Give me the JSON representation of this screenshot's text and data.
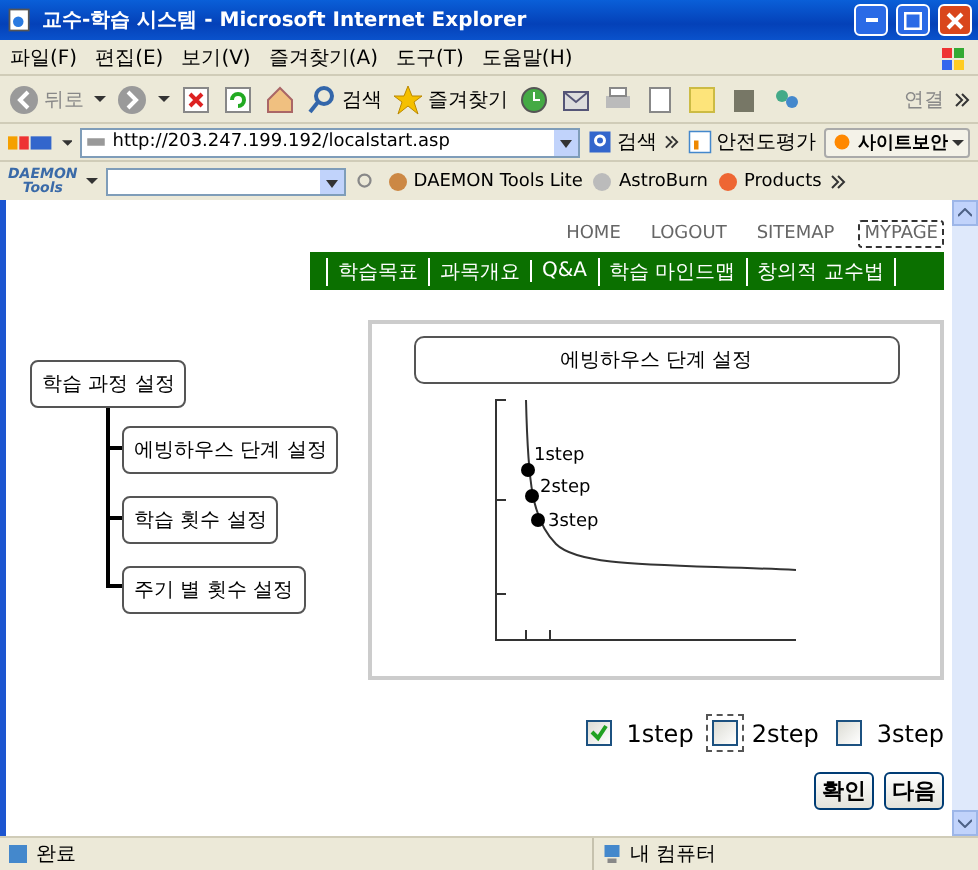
{
  "window": {
    "title": "교수-학습 시스템 - Microsoft Internet Explorer"
  },
  "menu_bar": [
    "파일(F)",
    "편집(E)",
    "보기(V)",
    "즐겨찾기(A)",
    "도구(T)",
    "도움말(H)"
  ],
  "toolbar": {
    "back": "뒤로",
    "search": "검색",
    "favorites": "즐겨찾기",
    "links": "연결"
  },
  "address_bar": {
    "url": "http://203.247.199.192/localstart.asp",
    "search": "검색",
    "safety": "안전도평가",
    "security": "사이트보안"
  },
  "daemon_bar": {
    "logo_top": "DAEMON",
    "logo_bottom": "Tools",
    "items": [
      "DAEMON Tools Lite",
      "AstroBurn",
      "Products"
    ]
  },
  "top_links": [
    {
      "label": "HOME",
      "focused": false
    },
    {
      "label": "LOGOUT",
      "focused": false
    },
    {
      "label": "SITEMAP",
      "focused": false
    },
    {
      "label": "MYPAGE",
      "focused": true
    }
  ],
  "nav": [
    "학습목표",
    "과목개요",
    "Q&A",
    "학습 마인드맵",
    "창의적 교수법"
  ],
  "tree": {
    "label": "학습 과정 설정",
    "children": [
      {
        "label": "에빙하우스 단계 설정"
      },
      {
        "label": "학습 횟수 설정"
      },
      {
        "label": "주기 별 횟수 설정"
      }
    ]
  },
  "panel": {
    "title": "에빙하우스 단계 설정",
    "curve_labels": [
      "1step",
      "2step",
      "3step"
    ]
  },
  "options": [
    {
      "label": "1step",
      "checked": true,
      "focused": false
    },
    {
      "label": "2step",
      "checked": false,
      "focused": true
    },
    {
      "label": "3step",
      "checked": false,
      "focused": false
    }
  ],
  "buttons": [
    "확인",
    "다음"
  ],
  "status_bar": {
    "status": "완료",
    "zone": "내 컴퓨터"
  }
}
